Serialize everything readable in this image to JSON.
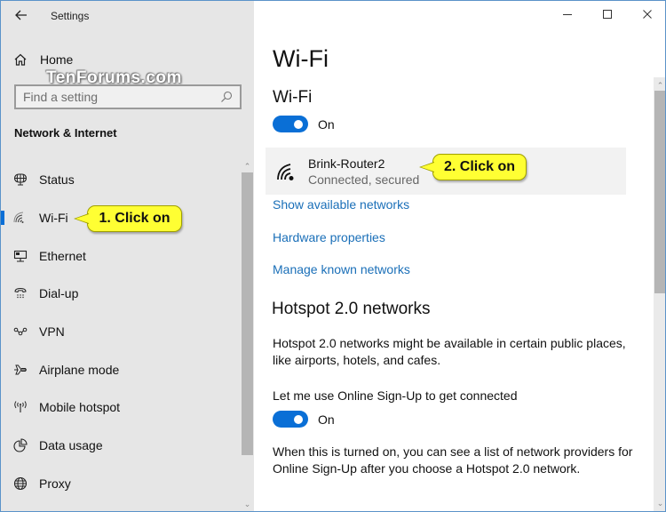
{
  "window": {
    "app_title": "Settings",
    "watermark": "TenForums.com",
    "controls": {
      "minimize": "minimize-icon",
      "maximize": "maximize-icon",
      "close": "close-icon"
    }
  },
  "sidebar": {
    "home_label": "Home",
    "search_placeholder": "Find a setting",
    "search_value": "",
    "section_title": "Network & Internet",
    "items": [
      {
        "label": "Status",
        "icon": "globe-monitor-icon",
        "active": false
      },
      {
        "label": "Wi-Fi",
        "icon": "wifi-icon",
        "active": true
      },
      {
        "label": "Ethernet",
        "icon": "ethernet-icon",
        "active": false
      },
      {
        "label": "Dial-up",
        "icon": "phone-icon",
        "active": false
      },
      {
        "label": "VPN",
        "icon": "vpn-icon",
        "active": false
      },
      {
        "label": "Airplane mode",
        "icon": "airplane-icon",
        "active": false
      },
      {
        "label": "Mobile hotspot",
        "icon": "hotspot-icon",
        "active": false
      },
      {
        "label": "Data usage",
        "icon": "pie-chart-icon",
        "active": false
      },
      {
        "label": "Proxy",
        "icon": "globe-icon",
        "active": false
      }
    ]
  },
  "callouts": {
    "step1": "1. Click on",
    "step2": "2. Click on"
  },
  "main": {
    "page_title": "Wi-Fi",
    "wifi_heading": "Wi-Fi",
    "wifi_toggle": {
      "state": "On",
      "on": true
    },
    "network": {
      "name": "Brink-Router2",
      "status": "Connected, secured"
    },
    "links": [
      "Show available networks",
      "Hardware properties",
      "Manage known networks"
    ],
    "hotspot": {
      "heading": "Hotspot 2.0 networks",
      "description": "Hotspot 2.0 networks might be available in certain public places, like airports, hotels, and cafes.",
      "signup_label": "Let me use Online Sign-Up to get connected",
      "signup_toggle": {
        "state": "On",
        "on": true
      },
      "signup_note": "When this is turned on, you can see a list of network providers for Online Sign-Up after you choose a Hotspot 2.0 network."
    }
  },
  "colors": {
    "accent": "#0a6fd6",
    "link": "#1a6fb8",
    "sidebar_bg": "#e6e6e6",
    "callout": "#ffff33"
  }
}
